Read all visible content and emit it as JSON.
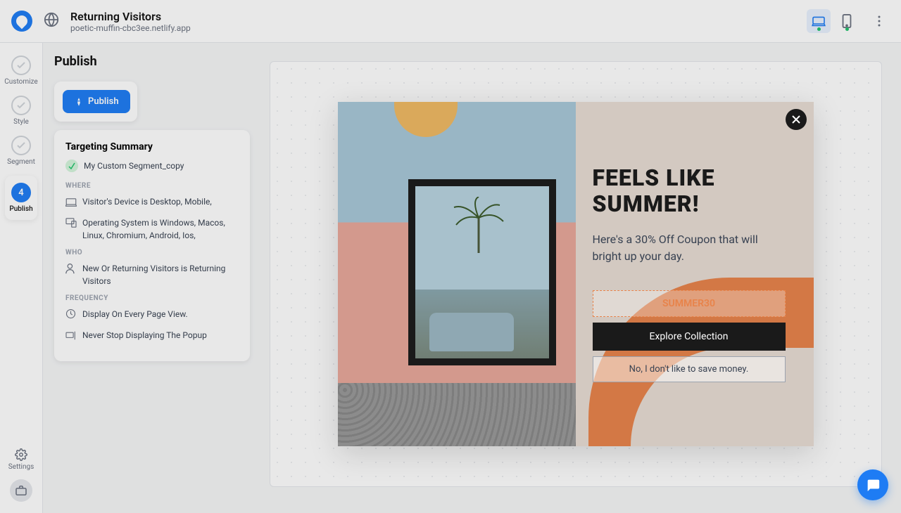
{
  "topbar": {
    "title": "Returning Visitors",
    "subtitle": "poetic-muffin-cbc3ee.netlify.app"
  },
  "sidebar": {
    "steps": [
      {
        "label": "Customize"
      },
      {
        "label": "Style"
      },
      {
        "label": "Segment"
      },
      {
        "num": "4",
        "label": "Publish"
      }
    ],
    "settings": "Settings"
  },
  "panel": {
    "heading": "Publish",
    "publish_btn": "Publish",
    "summary_heading": "Targeting Summary",
    "segment_name": "My Custom Segment_copy",
    "where_label": "WHERE",
    "where_rules": [
      "Visitor's Device is Desktop, Mobile,",
      "Operating System is Windows, Macos, Linux, Chromium, Android, Ios,"
    ],
    "who_label": "WHO",
    "who_rules": [
      "New Or Returning Visitors is Returning Visitors"
    ],
    "freq_label": "FREQUENCY",
    "freq_rules": [
      "Display On Every Page View.",
      "Never Stop Displaying The Popup"
    ]
  },
  "popup": {
    "heading": "FEELS LIKE SUMMER!",
    "sub": "Here's a 30% Off Coupon that will bright up your day.",
    "coupon": "SUMMER30",
    "cta": "Explore Collection",
    "decline": "No, I don't like to save money."
  }
}
